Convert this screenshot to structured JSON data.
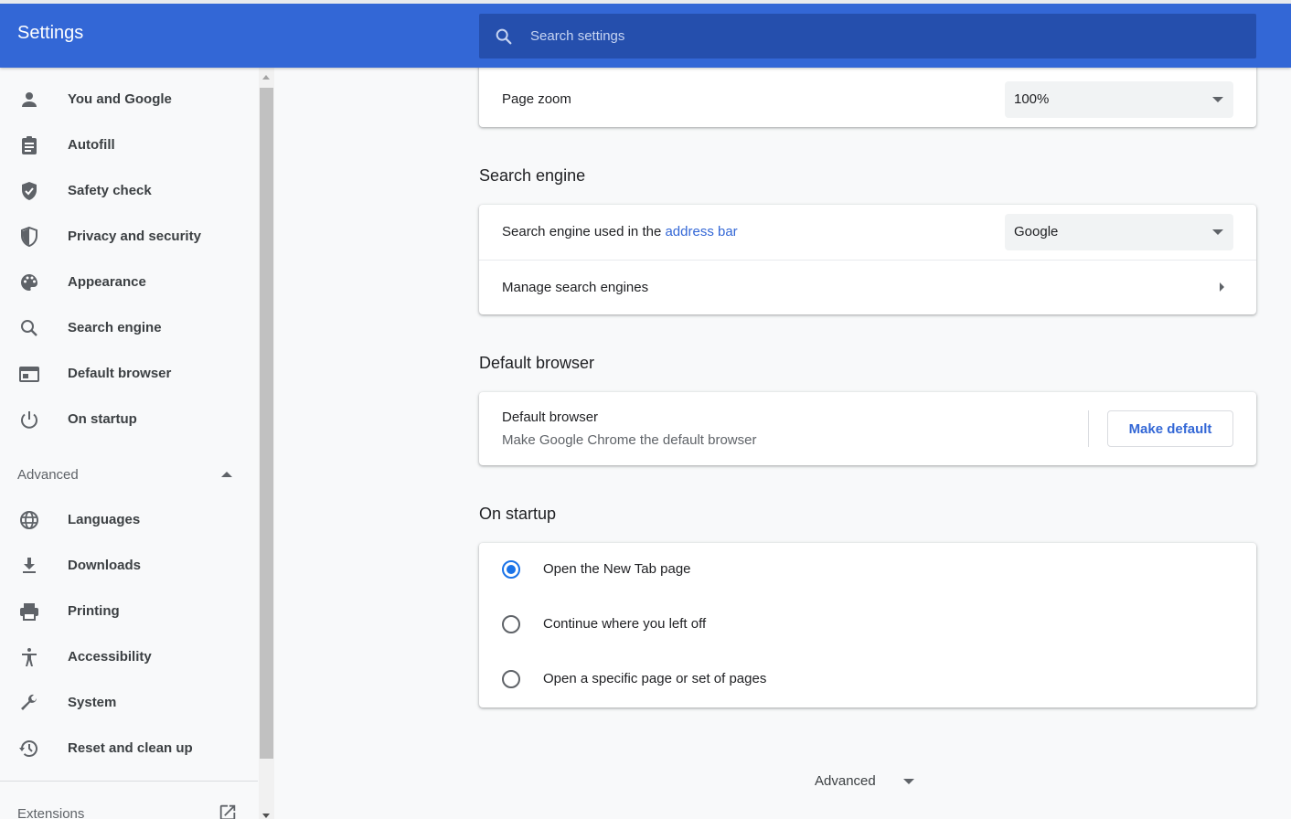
{
  "header": {
    "title": "Settings",
    "search_placeholder": "Search settings"
  },
  "sidebar": {
    "items": [
      {
        "label": "You and Google",
        "icon": "person-icon"
      },
      {
        "label": "Autofill",
        "icon": "clipboard-icon"
      },
      {
        "label": "Safety check",
        "icon": "shield-check-icon"
      },
      {
        "label": "Privacy and security",
        "icon": "shield-icon"
      },
      {
        "label": "Appearance",
        "icon": "palette-icon"
      },
      {
        "label": "Search engine",
        "icon": "search-icon"
      },
      {
        "label": "Default browser",
        "icon": "browser-icon"
      },
      {
        "label": "On startup",
        "icon": "power-icon"
      }
    ],
    "advanced_label": "Advanced",
    "advanced_items": [
      {
        "label": "Languages",
        "icon": "globe-icon"
      },
      {
        "label": "Downloads",
        "icon": "download-icon"
      },
      {
        "label": "Printing",
        "icon": "printer-icon"
      },
      {
        "label": "Accessibility",
        "icon": "accessibility-icon"
      },
      {
        "label": "System",
        "icon": "wrench-icon"
      },
      {
        "label": "Reset and clean up",
        "icon": "history-icon"
      }
    ],
    "extensions_label": "Extensions"
  },
  "main": {
    "page_zoom": {
      "label": "Page zoom",
      "value": "100%"
    },
    "search_engine": {
      "title": "Search engine",
      "row_prefix": "Search engine used in the ",
      "row_link": "address bar",
      "value": "Google",
      "manage_label": "Manage search engines"
    },
    "default_browser": {
      "title": "Default browser",
      "label": "Default browser",
      "sublabel": "Make Google Chrome the default browser",
      "button": "Make default"
    },
    "on_startup": {
      "title": "On startup",
      "options": [
        {
          "label": "Open the New Tab page",
          "checked": true
        },
        {
          "label": "Continue where you left off",
          "checked": false
        },
        {
          "label": "Open a specific page or set of pages",
          "checked": false
        }
      ]
    },
    "advanced_label": "Advanced"
  },
  "colors": {
    "header": "#3367d6",
    "search_box": "#254fad",
    "accent": "#1a73e8",
    "link": "#3367d6"
  }
}
